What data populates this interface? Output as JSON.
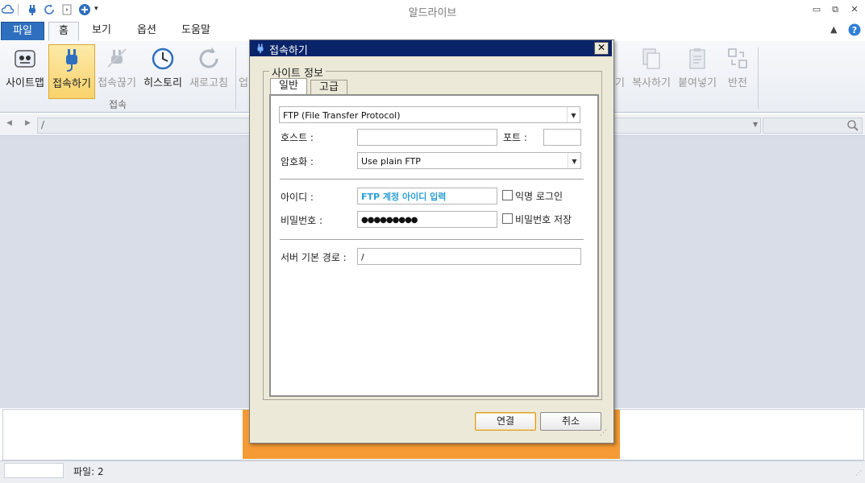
{
  "window": {
    "title": "알드라이브",
    "minimize": "▭",
    "restore": "⧉",
    "close": "✕"
  },
  "quick_access": [
    "cloud-icon",
    "plug-icon",
    "refresh-icon",
    "file-icon",
    "add-circle-icon",
    "dropdown-icon"
  ],
  "tabs": [
    {
      "label": "파일",
      "type": "file"
    },
    {
      "label": "홈",
      "active": true
    },
    {
      "label": "보기"
    },
    {
      "label": "옵션"
    },
    {
      "label": "도움말"
    }
  ],
  "ribbon": {
    "buttons": [
      {
        "label": "사이트맵",
        "icon": "sitemap-icon"
      },
      {
        "label": "접속하기",
        "icon": "plug-icon",
        "selected": true
      },
      {
        "label": "접속끊기",
        "icon": "unplug-icon",
        "disabled": true
      },
      {
        "label": "히스토리",
        "icon": "clock-icon"
      },
      {
        "label": "새로고침",
        "icon": "refresh-icon",
        "disabled": true
      },
      {
        "label": "업",
        "icon": "upload-icon",
        "disabled": true
      }
    ],
    "group_label": "접속",
    "right_buttons": [
      {
        "label": "기",
        "disabled": true
      },
      {
        "label": "복사하기",
        "icon": "copy-icon",
        "disabled": true
      },
      {
        "label": "붙여넣기",
        "icon": "paste-icon",
        "disabled": true
      },
      {
        "label": "반전",
        "icon": "invert-icon",
        "disabled": true
      }
    ]
  },
  "address": {
    "path": "/",
    "back": "◀",
    "forward": "▶"
  },
  "status": {
    "files": "파일: 2"
  },
  "dialog": {
    "title": "접속하기",
    "close": "✕",
    "group_label": "사이트 정보",
    "tabs": [
      "일반",
      "고급"
    ],
    "protocol": "FTP (File Transfer Protocol)",
    "host_label": "호스트 :",
    "host_value": "",
    "port_label": "포트 :",
    "port_value": "",
    "encryption_label": "암호화 :",
    "encryption_value": "Use plain FTP",
    "id_label": "아이디 :",
    "id_placeholder": "FTP 계정 아이디 입력",
    "anonymous_label": "익명 로그인",
    "password_label": "비밀번호 :",
    "password_value": "●●●●●●●●●",
    "save_password_label": "비밀번호 저장",
    "base_path_label": "서버 기본 경로 :",
    "base_path_value": "/",
    "connect_label": "연결",
    "cancel_label": "취소"
  },
  "colors": {
    "accent": "#2f6fbf",
    "title_bar": "#0a246a",
    "highlight": "#f8d36c",
    "orange": "#f59a34",
    "placeholder": "#2a9fd6"
  }
}
